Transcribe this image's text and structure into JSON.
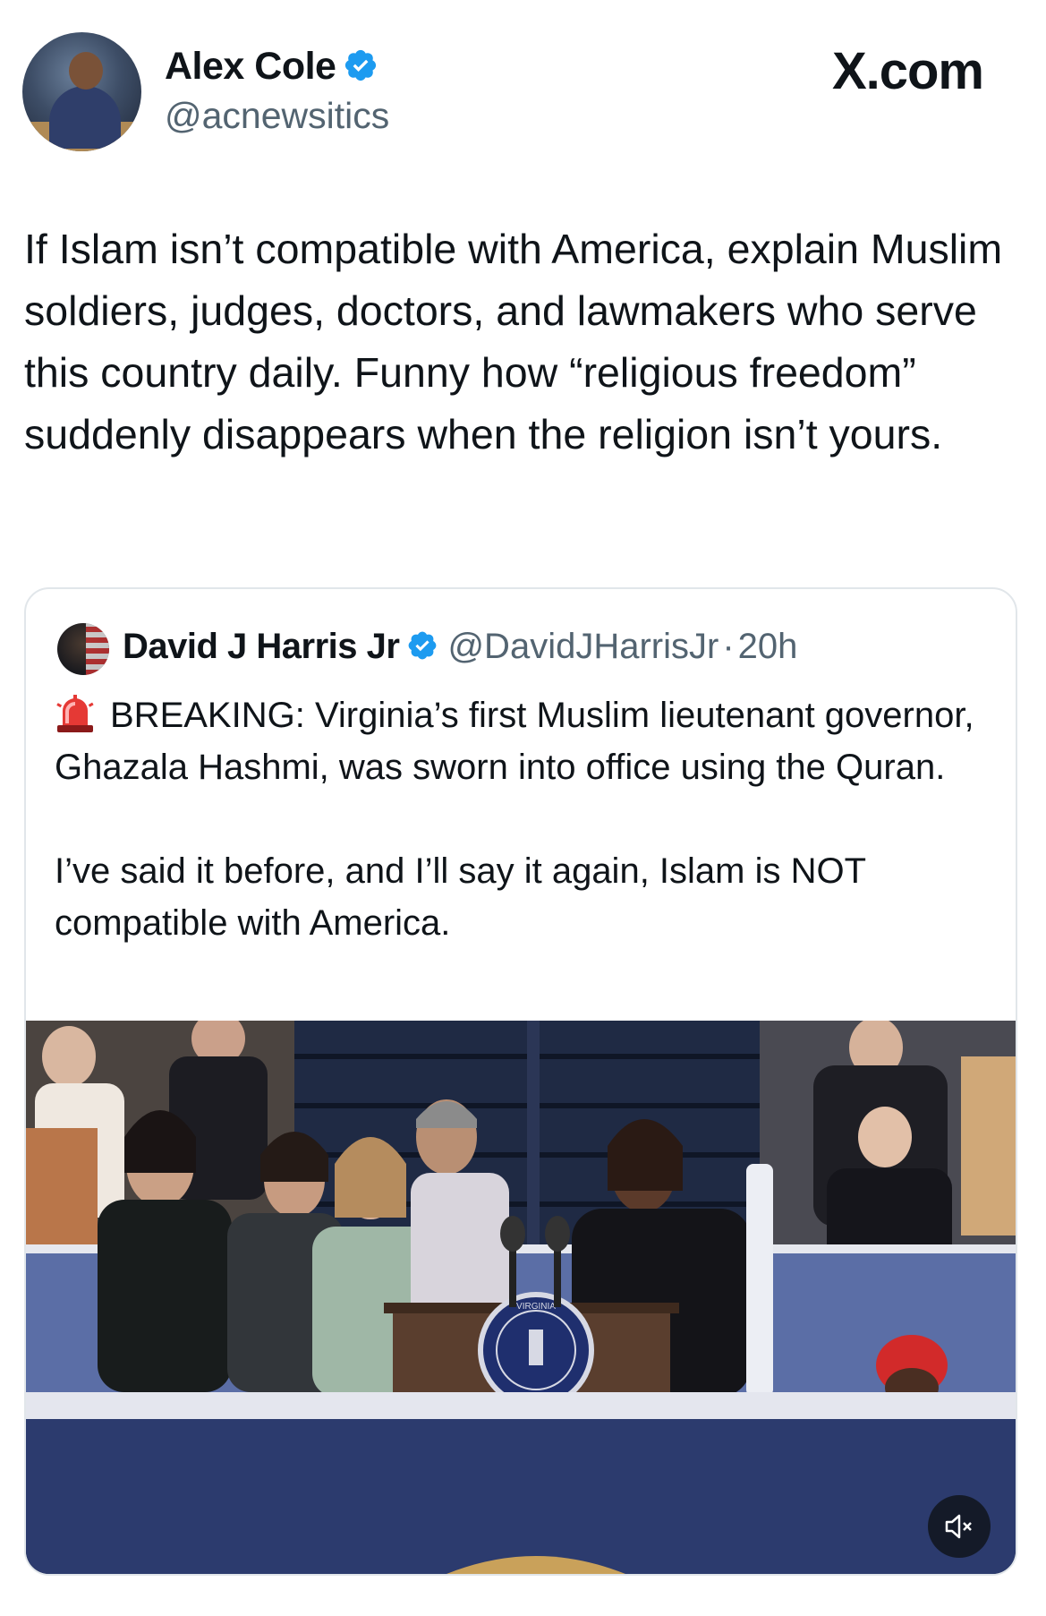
{
  "post": {
    "author": {
      "name": "Alex Cole",
      "handle": "@acnewsitics",
      "verified": true
    },
    "brand": "X.com",
    "text": "If Islam isn’t compatible with America, explain Muslim soldiers, judges, doctors, and lawmakers who serve this country daily.  Funny how “religious freedom” suddenly disappears when the religion isn’t yours."
  },
  "quoted": {
    "author": {
      "name": "David J Harris Jr",
      "handle": "@DavidJHarrisJr",
      "verified": true
    },
    "separator": "·",
    "time": "20h",
    "paragraph1": "BREAKING: Virginia’s first Muslim lieutenant governor, Ghazala Hashmi, was sworn into office using the Quran.",
    "paragraph2": "I’ve said it before, and I’ll say it again, Islam is NOT compatible with America.",
    "media": {
      "type": "video",
      "muted": true,
      "seal_text": "VIRGINIA"
    }
  },
  "colors": {
    "verified_blue": "#1d9bf0",
    "text_primary": "#0f1419",
    "text_secondary": "#536471",
    "card_border": "#e1e6ea"
  },
  "icons": {
    "verified": "verified-badge-icon",
    "siren": "siren-emoji-icon",
    "mute": "speaker-muted-icon"
  }
}
